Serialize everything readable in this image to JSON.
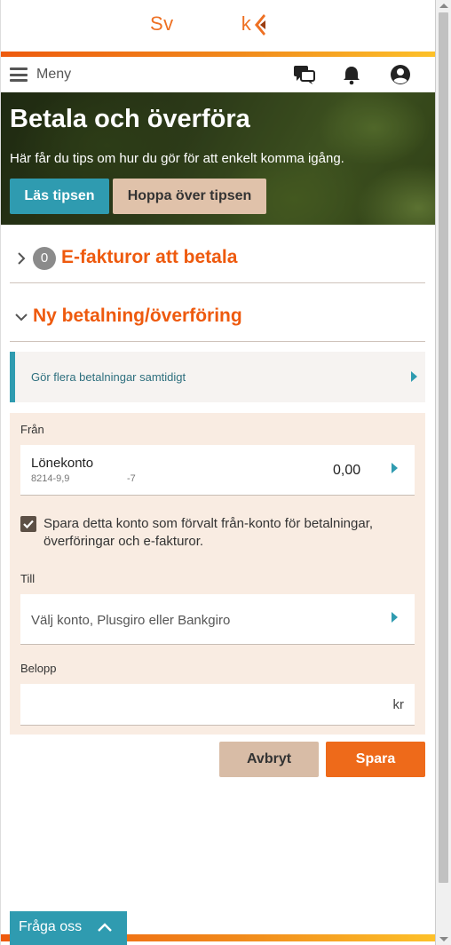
{
  "header": {
    "logo_left": "Sv",
    "logo_right": "k",
    "brand_color": "#ee7023"
  },
  "nav": {
    "menu_label": "Meny",
    "icons": [
      "chat-icon",
      "bell-icon",
      "user-icon"
    ]
  },
  "hero": {
    "title": "Betala och överföra",
    "text": "Här får du tips om hur du gör för att enkelt komma igång.",
    "read_tips": "Läs tipsen",
    "skip_tips": "Hoppa över tipsen"
  },
  "efaktura": {
    "count": "0",
    "title": "E-fakturor att betala"
  },
  "new_payment": {
    "title": "Ny betalning/överföring",
    "multi_label": "Gör flera betalningar samtidigt"
  },
  "form": {
    "from_label": "Från",
    "from_account": {
      "name": "Lönekonto",
      "number": "8214-9,9",
      "suffix": "-7",
      "balance": "0,00"
    },
    "save_default_checked": true,
    "save_default_text": "Spara detta konto som förvalt från-konto för betalningar, överföringar och e-fakturor.",
    "to_label": "Till",
    "to_placeholder": "Välj konto, Plusgiro eller Bankgiro",
    "amount_label": "Belopp",
    "amount_unit": "kr"
  },
  "actions": {
    "cancel": "Avbryt",
    "save": "Spara"
  },
  "help": {
    "ask_label": "Fråga oss"
  },
  "colors": {
    "accent_orange": "#ee5a0e",
    "teal": "#2f9bb0",
    "form_bg": "#f9ece2"
  }
}
